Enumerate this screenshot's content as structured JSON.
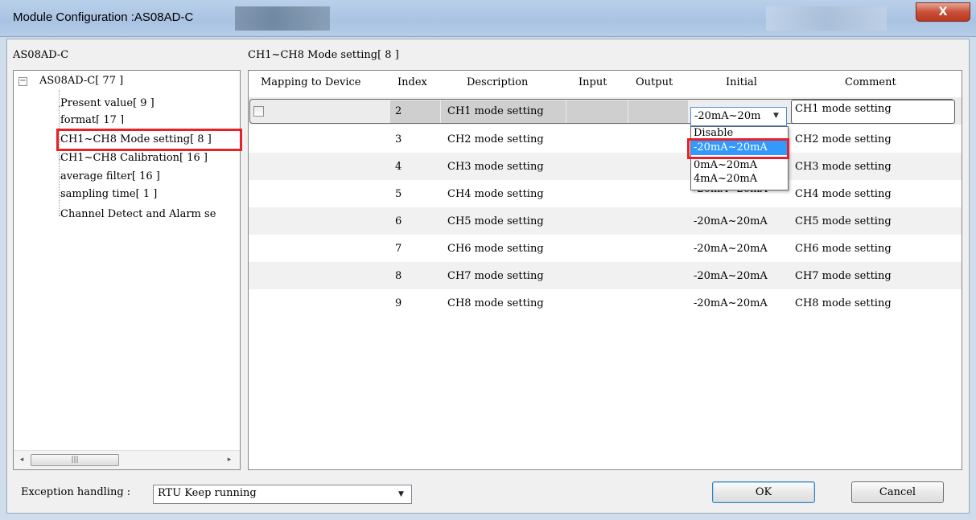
{
  "window": {
    "title": "Module Configuration :AS08AD-C",
    "close_icon": "close-icon",
    "close_glyph": "X"
  },
  "module_label": "AS08AD-C",
  "section_title": "CH1~CH8 Mode setting[ 8 ]",
  "tree": {
    "expander_glyph": "−",
    "root": "AS08AD-C[ 77 ]",
    "items": [
      "Present value[ 9 ]",
      "format[ 17 ]",
      "CH1~CH8 Mode setting[ 8 ]",
      "CH1~CH8 Calibration[ 16 ]",
      "average filter[ 16 ]",
      "sampling time[ 1 ]",
      "Channel Detect and Alarm se"
    ],
    "selected_index": 2,
    "scroll_left_glyph": "◂",
    "scroll_thumb_glyph": "|||",
    "scroll_right_glyph": "▸"
  },
  "grid": {
    "columns": [
      "Mapping to Device",
      "Index",
      "Description",
      "Input",
      "Output",
      "Initial",
      "Comment"
    ],
    "rows": [
      {
        "index": "2",
        "description": "CH1 mode setting",
        "initial": "-20mA~20m",
        "comment": "CH1 mode setting"
      },
      {
        "index": "3",
        "description": "CH2 mode setting",
        "initial": "",
        "comment": "CH2 mode setting"
      },
      {
        "index": "4",
        "description": "CH3 mode setting",
        "initial": "",
        "comment": "CH3 mode setting"
      },
      {
        "index": "5",
        "description": "CH4 mode setting",
        "initial": "-20mA~20mA",
        "comment": "CH4 mode setting"
      },
      {
        "index": "6",
        "description": "CH5 mode setting",
        "initial": "-20mA~20mA",
        "comment": "CH5 mode setting"
      },
      {
        "index": "7",
        "description": "CH6 mode setting",
        "initial": "-20mA~20mA",
        "comment": "CH6 mode setting"
      },
      {
        "index": "8",
        "description": "CH7 mode setting",
        "initial": "-20mA~20mA",
        "comment": "CH7 mode setting"
      },
      {
        "index": "9",
        "description": "CH8 mode setting",
        "initial": "-20mA~20mA",
        "comment": "CH8 mode setting"
      }
    ],
    "combo_arrow_glyph": "▼",
    "dropdown_options": [
      "Disable",
      "-20mA~20mA",
      "0mA~20mA",
      "4mA~20mA"
    ],
    "dropdown_selected_index": 1
  },
  "footer": {
    "exception_label": "Exception handling :",
    "exception_value": "RTU Keep running",
    "exception_arrow_glyph": "▼",
    "ok_label": "OK",
    "cancel_label": "Cancel"
  },
  "colors": {
    "highlight_red": "#e8202a",
    "selection_blue": "#3399ff",
    "row_alt": "#ededed"
  }
}
